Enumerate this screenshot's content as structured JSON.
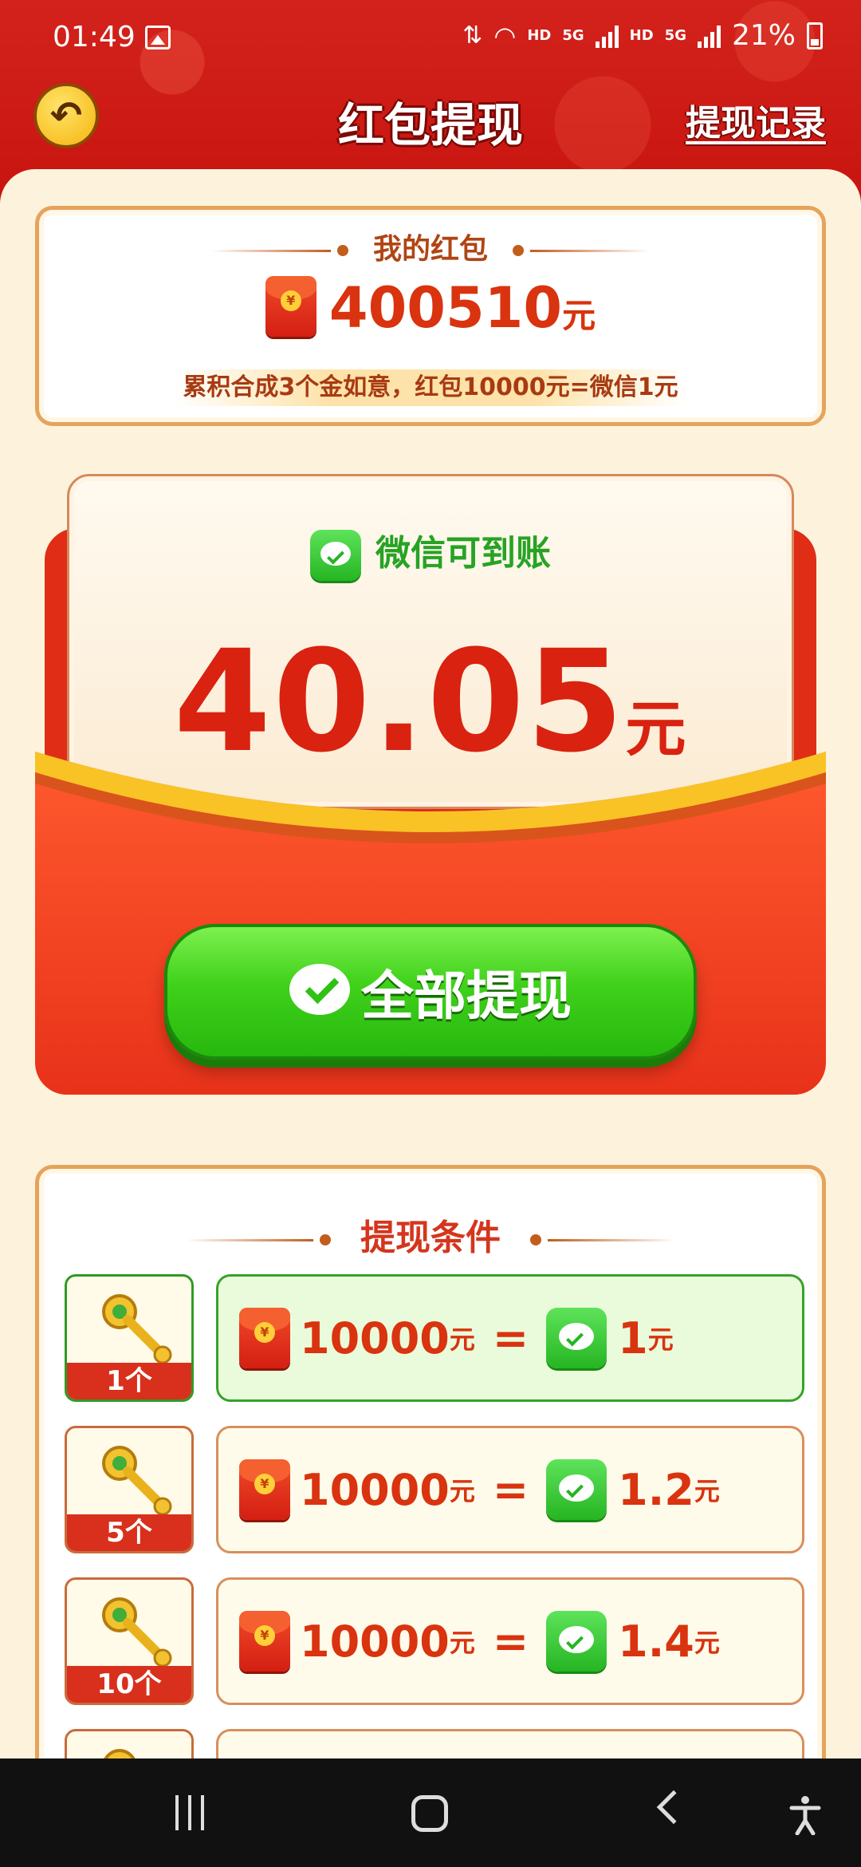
{
  "status_bar": {
    "time": "01:49",
    "network_1": "HD",
    "network_2": "5G",
    "network_3": "HD",
    "network_4": "5G",
    "battery": "21%"
  },
  "header": {
    "title": "红包提现",
    "records_link": "提现记录",
    "back_icon": "back-arrow-icon"
  },
  "my_packet": {
    "title": "我的红包",
    "amount": "400510",
    "unit": "元",
    "note": "累积合成3个金如意，红包10000元=微信1元"
  },
  "envelope": {
    "wechat_label": "微信可到账",
    "amount": "40.05",
    "unit": "元",
    "withdraw_button": "全部提现"
  },
  "conditions": {
    "title": "提现条件",
    "rows": [
      {
        "keys": "1个",
        "packet": "10000",
        "packet_unit": "元",
        "eq": "=",
        "wechat": "1",
        "wechat_unit": "元",
        "active": true
      },
      {
        "keys": "5个",
        "packet": "10000",
        "packet_unit": "元",
        "eq": "=",
        "wechat": "1.2",
        "wechat_unit": "元",
        "active": false
      },
      {
        "keys": "10个",
        "packet": "10000",
        "packet_unit": "元",
        "eq": "=",
        "wechat": "1.4",
        "wechat_unit": "元",
        "active": false
      }
    ]
  },
  "colors": {
    "brand_red": "#d3221c",
    "wechat_green": "#27b80e",
    "cream": "#fdf3dc",
    "amount_red": "#d9220f"
  }
}
